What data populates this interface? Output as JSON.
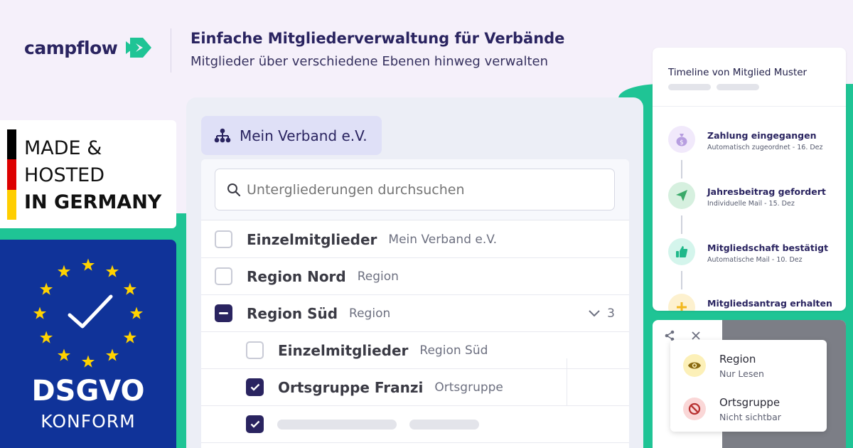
{
  "brand": {
    "name": "campflow",
    "title": "Einfache Mitgliederverwaltung für Verbände",
    "subtitle": "Mitglieder über verschiedene Ebenen hinweg verwalten",
    "colors": {
      "navy": "#2a2460",
      "green": "#1fc495",
      "eu_blue": "#103399",
      "star": "#ffd200"
    }
  },
  "badge_de": {
    "line1": "MADE &",
    "line2": "HOSTED",
    "line3": "IN GERMANY",
    "flag_colors": [
      "#000000",
      "#dd0000",
      "#ffce00"
    ]
  },
  "badge_eu": {
    "line1": "DSGVO",
    "line2": "KONFORM",
    "icon": "check-icon"
  },
  "org": {
    "chip_label": "Mein Verband e.V.",
    "chip_icon": "hierarchy-icon",
    "search_placeholder": "Untergliederungen durchsuchen",
    "rows": [
      {
        "name": "Einzelmitglieder",
        "sub": "Mein Verband e.V.",
        "state": "unchecked"
      },
      {
        "name": "Region Nord",
        "sub": "Region",
        "state": "unchecked"
      },
      {
        "name": "Region Süd",
        "sub": "Region",
        "state": "indeterminate",
        "count": "3"
      },
      {
        "name": "Einzelmitglieder",
        "sub": "Region Süd",
        "state": "unchecked"
      },
      {
        "name": "Ortsgruppe Franzi",
        "sub": "Ortsgruppe",
        "state": "checked"
      },
      {
        "name": "",
        "sub": "",
        "state": "checked"
      }
    ]
  },
  "timeline": {
    "title": "Timeline von Mitglied Muster",
    "items": [
      {
        "title": "Zahlung eingegangen",
        "sub": "Automatisch zugeordnet - 16. Dez",
        "icon": "money-bag-icon",
        "color": "#f1e9fb"
      },
      {
        "title": "Jahresbeitrag gefordert",
        "sub": "Individuelle Mail - 15. Dez",
        "icon": "send-icon",
        "color": "#d6f0df"
      },
      {
        "title": "Mitgliedschaft bestätigt",
        "sub": "Automatische Mail - 10. Dez",
        "icon": "thumbs-up-icon",
        "color": "#d4f5ec"
      },
      {
        "title": "Mitgliedsantrag erhalten",
        "sub": "",
        "icon": "plus-icon",
        "color": "#fdf1cf"
      }
    ]
  },
  "permissions": {
    "items": [
      {
        "name": "Region",
        "sub": "Nur Lesen",
        "icon": "eye-icon",
        "color": "#fcf0b8"
      },
      {
        "name": "Ortsgruppe",
        "sub": "Nicht sichtbar",
        "icon": "forbidden-icon",
        "color": "#fad7d7"
      }
    ]
  }
}
